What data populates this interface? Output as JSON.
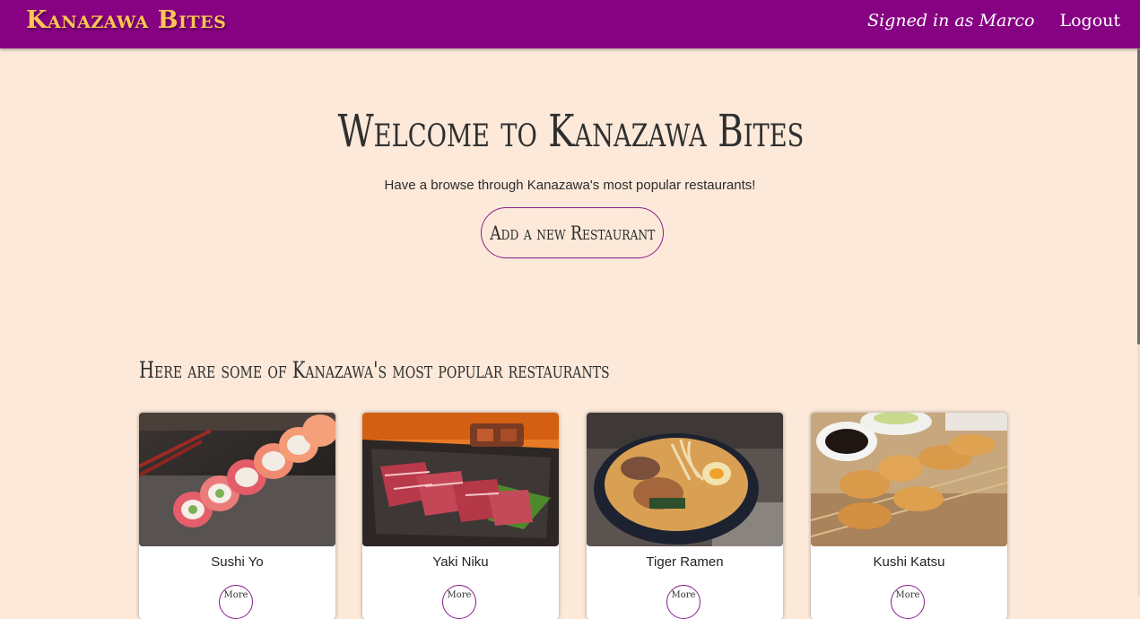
{
  "navbar": {
    "brand": "Kanazawa Bites",
    "signed_in": "Signed in as Marco",
    "logout": "Logout"
  },
  "hero": {
    "title": "Welcome to Kanazawa Bites",
    "subtitle": "Have a browse through Kanazawa's most popular restaurants!",
    "add_button": "Add a new Restaurant"
  },
  "section": {
    "title": "Here are some of Kanazawa's most popular restaurants"
  },
  "restaurants": [
    {
      "name": "Sushi Yo",
      "more_label": "More",
      "image": "sushi-rolls-photo"
    },
    {
      "name": "Yaki Niku",
      "more_label": "More",
      "image": "grilled-beef-photo"
    },
    {
      "name": "Tiger Ramen",
      "more_label": "More",
      "image": "ramen-bowl-photo"
    },
    {
      "name": "Kushi Katsu",
      "more_label": "More",
      "image": "fried-skewers-photo"
    }
  ],
  "colors": {
    "navbar": "#870183",
    "brand": "#ffc455",
    "background": "#fce9d9",
    "accent_border": "#8b1d8e"
  }
}
